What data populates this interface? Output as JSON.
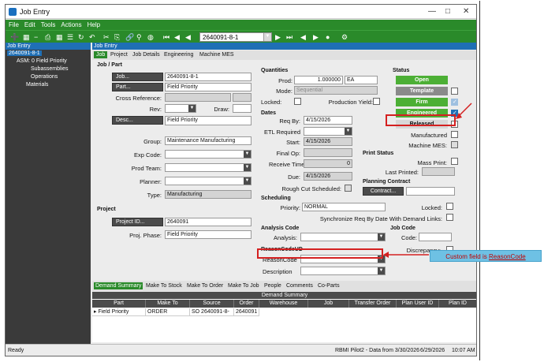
{
  "window": {
    "title": "Job Entry"
  },
  "menu": [
    "File",
    "Edit",
    "Tools",
    "Actions",
    "Help"
  ],
  "toolbar": {
    "job_value": "2640091-8-1"
  },
  "tree": {
    "header": "Job Entry",
    "root": "2640091-8-1",
    "asm": "ASM: 0 Field Priority",
    "subassemblies": "Subassemblies",
    "operations": "Operations",
    "materials": "Materials"
  },
  "panel_header": "Job Entry",
  "tabs": [
    "Job",
    "Project",
    "Job Details",
    "Engineering",
    "Machine MES"
  ],
  "jobpart": {
    "section": "Job / Part",
    "job_btn": "Job...",
    "job_value": "2640091-8-1",
    "part_btn": "Part...",
    "part_value": "Field Priority",
    "crossref_label": "Cross Reference:",
    "rev_label": "Rev:",
    "draw_label": "Draw:",
    "desc_btn": "Desc...",
    "desc_value": "Field Priority"
  },
  "classify": {
    "group_label": "Group:",
    "group_value": "Maintenance Manufacturing",
    "expcode_label": "Exp Code:",
    "prodteam_label": "Prod Team:",
    "planner_label": "Planner:",
    "type_label": "Type:",
    "type_value": "Manufacturing"
  },
  "project": {
    "section": "Project",
    "project_btn": "Project ID...",
    "project_value": "2640091",
    "phase_label": "Proj. Phase:",
    "phase_value": "Field Priority"
  },
  "quantities": {
    "section": "Quantities",
    "prod_label": "Prod:",
    "prod_value": "1.000000",
    "uom": "EA",
    "mode_label": "Mode:",
    "mode_value": "Sequential",
    "locked_label": "Locked:",
    "yield_label": "Production Yield:"
  },
  "dates": {
    "section": "Dates",
    "reqby_label": "Req By:",
    "reqby_value": "4/15/2026",
    "etl_label": "ETL Required",
    "start_label": "Start:",
    "start_value": "4/15/2026",
    "finalop_label": "Final Op:",
    "receive_label": "Receive Time:",
    "receive_value": "0",
    "due_label": "Due:",
    "due_value": "4/15/2026",
    "roughcut_label": "Rough Cut Scheduled:"
  },
  "scheduling": {
    "section": "Scheduling",
    "priority_label": "Priority:",
    "priority_value": "NORMAL",
    "locked_label": "Locked:",
    "sync_label": "Synchronize Req By Date With Demand Links:"
  },
  "analysis": {
    "section": "Analysis Code",
    "label": "Analysis:"
  },
  "jobcode": {
    "section": "Job Code",
    "code_label": "Code:",
    "discrepancy_label": "Discrepancy:"
  },
  "reason": {
    "section": "ReasonCodeUD",
    "code_label": "ReasonCode",
    "desc_label": "Description"
  },
  "status": {
    "section": "Status",
    "open": "Open",
    "template": "Template",
    "firm": "Firm",
    "engineered": "Engineered",
    "released": "Released",
    "manufactured": "Manufactured",
    "machine_mes": "Machine MES:",
    "colors": {
      "open": "#4caf35",
      "template": "#8a8a8a",
      "firm": "#4caf35",
      "engineered": "#4caf35"
    }
  },
  "print_status": {
    "section": "Print Status",
    "mass_print": "Mass Print:",
    "last_printed": "Last Printed:"
  },
  "planning": {
    "section": "Planning Contract",
    "btn": "Contract..."
  },
  "bottom_tabs": [
    "Demand Summary",
    "Make To Stock",
    "Make To Order",
    "Make To Job",
    "People",
    "Comments",
    "Co-Parts"
  ],
  "grid": {
    "title": "Demand Summary",
    "headers": [
      "Part",
      "Make To",
      "Source",
      "Order",
      "Warehouse",
      "Job",
      "Transfer Order",
      "Plan User ID",
      "Plan ID"
    ],
    "row": [
      "Field Priority",
      "ORDER",
      "SO 2640091-8-",
      "2640091",
      "",
      "",
      "",
      "",
      ""
    ]
  },
  "statusbar": {
    "left": "Ready",
    "right": "RBMI Pilot2 - Data from 3/30/2026",
    "date": "6/29/2026",
    "time": "10:07 AM"
  },
  "callout": {
    "prefix": "Custom field is ",
    "link": "ReasonCode"
  }
}
